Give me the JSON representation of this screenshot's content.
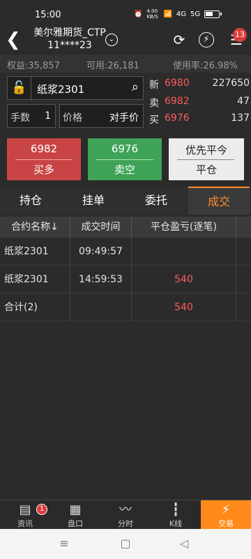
{
  "status": {
    "time": "15:00",
    "net_speed": "4.00 KB/S",
    "sim1": "4G",
    "sim2": "5G"
  },
  "header": {
    "title_line1": "美尔雅期货_CTP",
    "title_line2": "11****23",
    "badge": "13"
  },
  "account": {
    "equity": "权益:35,857",
    "available": "可用:26,181",
    "usage": "使用率:26.98%"
  },
  "order": {
    "symbol": "纸浆2301",
    "qty_label": "手数",
    "qty_value": "1",
    "price_label": "价格",
    "price_value": "对手价"
  },
  "quote": {
    "last_label": "新",
    "last_price": "6980",
    "last_volume": "227650",
    "ask_label": "卖",
    "ask_price": "6982",
    "ask_volume": "47",
    "bid_label": "买",
    "bid_price": "6976",
    "bid_volume": "137"
  },
  "actions": {
    "buy_price": "6982",
    "buy_label": "买多",
    "sell_price": "6976",
    "sell_label": "卖空",
    "close_line1": "优先平今",
    "close_line2": "平仓"
  },
  "tabs": [
    "持仓",
    "挂单",
    "委托",
    "成交"
  ],
  "table": {
    "headers": [
      "合约名称↓",
      "成交时间",
      "平仓盈亏(逐笔)"
    ],
    "rows": [
      {
        "name": "纸浆2301",
        "time": "09:49:57",
        "pnl": ""
      },
      {
        "name": "纸浆2301",
        "time": "14:59:53",
        "pnl": "540"
      },
      {
        "name": "合计(2)",
        "time": "",
        "pnl": "540"
      }
    ]
  },
  "bottom_nav": [
    "资讯",
    "盘口",
    "分时",
    "K线",
    "交易"
  ],
  "bottom_nav_badge": "1"
}
